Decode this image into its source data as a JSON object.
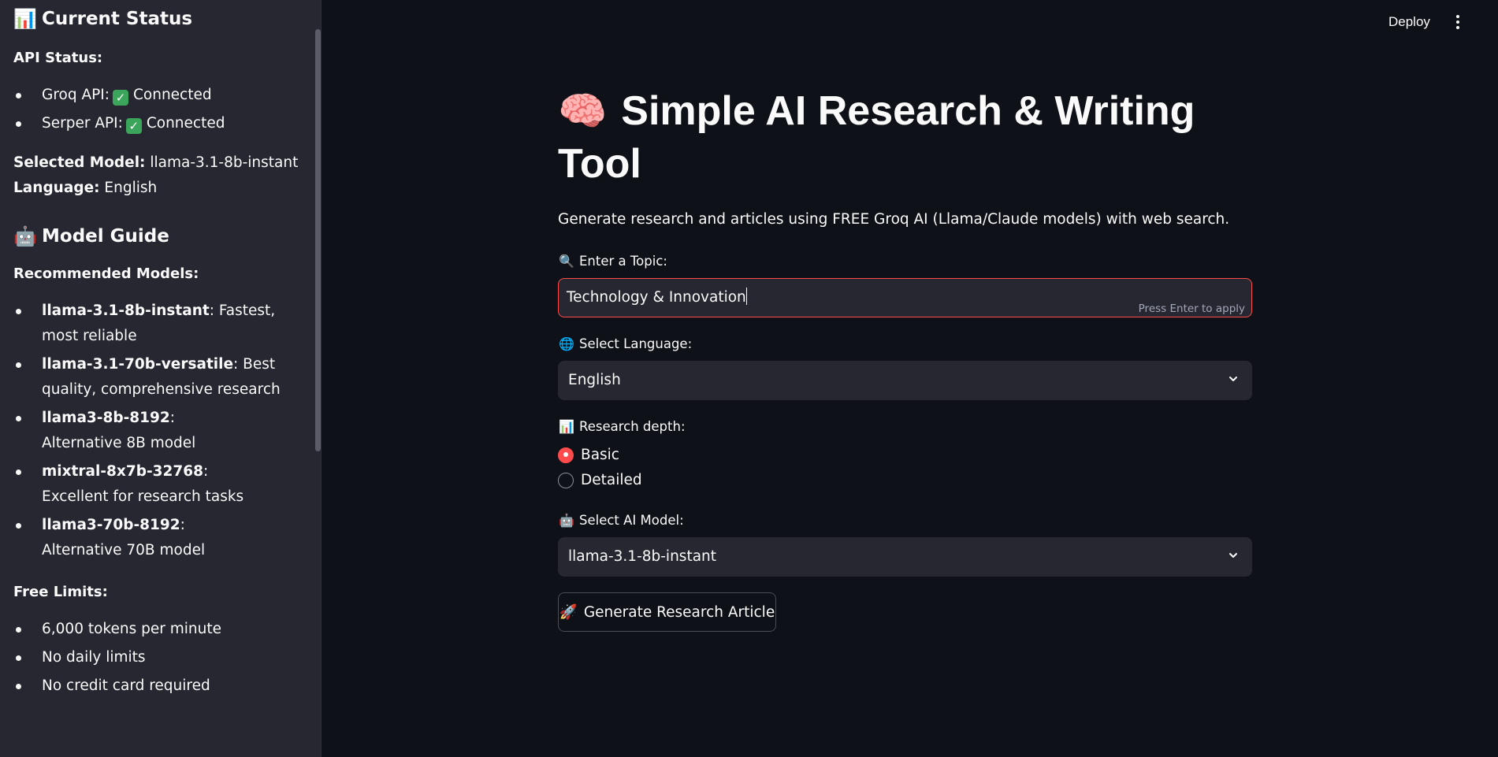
{
  "sidebar": {
    "current_status": {
      "icon": "bar-chart-emoji",
      "emoji": "📊",
      "title": "Current Status"
    },
    "api_status_label": "API Status:",
    "api_items": [
      {
        "name": "Groq API:",
        "status": "Connected"
      },
      {
        "name": "Serper API:",
        "status": "Connected"
      }
    ],
    "selected_model_label": "Selected Model:",
    "selected_model_value": "llama-3.1-8b-instant",
    "language_label": "Language:",
    "language_value": "English",
    "model_guide": {
      "icon": "robot-emoji",
      "emoji": "🤖",
      "title": "Model Guide"
    },
    "recommended_label": "Recommended Models:",
    "models": [
      {
        "name": "llama-3.1-8b-instant",
        "desc": ": Fastest, most reliable"
      },
      {
        "name": "llama-3.1-70b-versatile",
        "desc": ": Best quality, comprehensive research"
      },
      {
        "name": "llama3-8b-8192",
        "desc": ": Alternative 8B model"
      },
      {
        "name": "mixtral-8x7b-32768",
        "desc": ": Excellent for research tasks"
      },
      {
        "name": "llama3-70b-8192",
        "desc": ": Alternative 70B model"
      }
    ],
    "free_limits_label": "Free Limits:",
    "limits": [
      "6,000 tokens per minute",
      "No daily limits",
      "No credit card required"
    ]
  },
  "header": {
    "deploy_label": "Deploy",
    "menu_icon": "more-vertical-icon"
  },
  "main": {
    "title_emoji": "🧠",
    "title": "Simple AI Research & Writing Tool",
    "subtitle": "Generate research and articles using FREE Groq AI (Llama/Claude models) with web search.",
    "topic": {
      "emoji": "🔍",
      "label": "Enter a Topic:",
      "value": "Technology & Innovation",
      "hint": "Press Enter to apply"
    },
    "language": {
      "emoji": "🌐",
      "label": "Select Language:",
      "selected": "English"
    },
    "depth": {
      "emoji": "📊",
      "label": "Research depth:",
      "options": [
        "Basic",
        "Detailed"
      ],
      "selected": "Basic"
    },
    "model": {
      "emoji": "🤖",
      "label": "Select AI Model:",
      "selected": "llama-3.1-8b-instant"
    },
    "generate_button": {
      "emoji": "🚀",
      "label": "Generate Research Article"
    }
  },
  "colors": {
    "accent": "#ff4b4b",
    "background": "#0e1117",
    "sidebar": "#262730",
    "check": "#3ba55c"
  }
}
